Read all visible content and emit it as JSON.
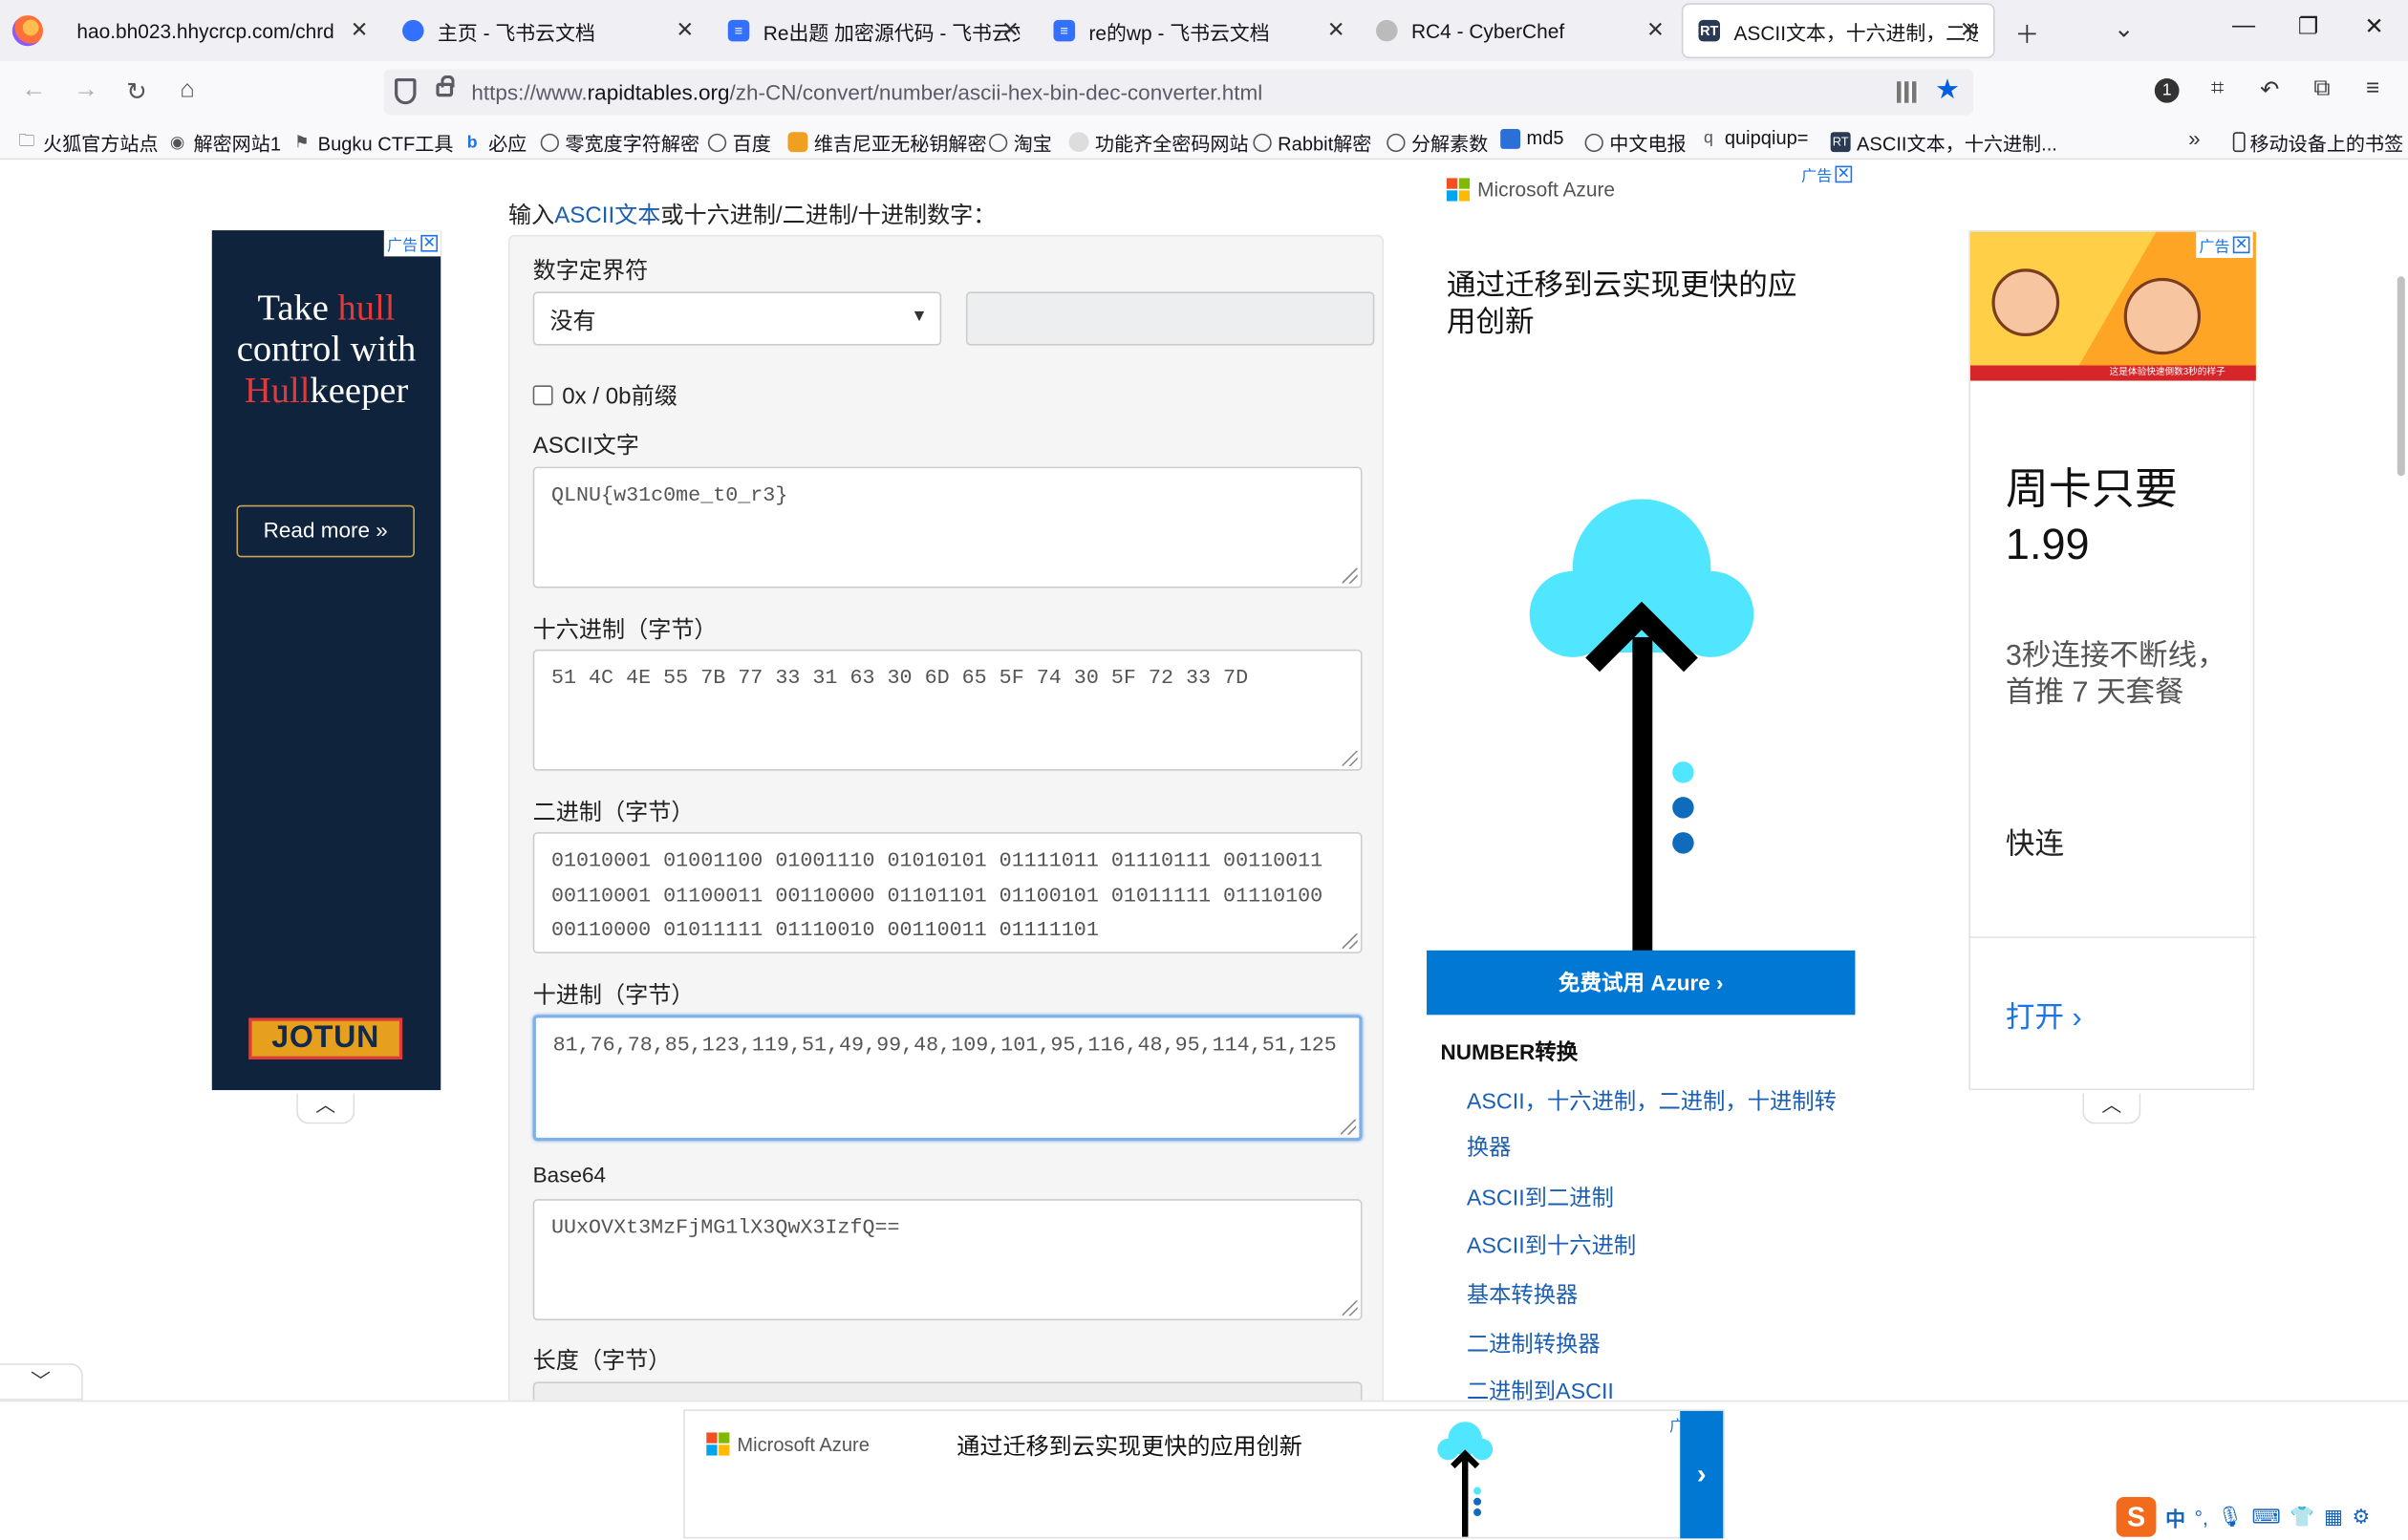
{
  "tabs": [
    {
      "title": "hao.bh023.hhycrcp.com/chrd",
      "icon_color": "",
      "icon_text": ""
    },
    {
      "title": "主页 - 飞书云文档",
      "icon_color": "#3370ff",
      "icon_text": ""
    },
    {
      "title": "Re出题 加密源代码 - 飞书云文档",
      "icon_color": "#3370ff",
      "icon_text": ""
    },
    {
      "title": "re的wp - 飞书云文档",
      "icon_color": "#3370ff",
      "icon_text": ""
    },
    {
      "title": "RC4 - CyberChef",
      "icon_color": "#bbbbbb",
      "icon_text": ""
    },
    {
      "title": "ASCII文本，十六进制，二进制",
      "icon_color": "#2a3a55",
      "icon_text": "RT"
    }
  ],
  "url": {
    "prefix": "https://www.",
    "domain": "rapidtables.org",
    "path": "/zh-CN/convert/number/ascii-hex-bin-dec-converter.html"
  },
  "bookmarks": [
    {
      "label": "火狐官方站点",
      "icon": "folder-icon"
    },
    {
      "label": "解密网站1",
      "icon": "site-icon"
    },
    {
      "label": "Bugku CTF工具",
      "icon": "flag-icon"
    },
    {
      "label": "必应",
      "icon": "bing-icon"
    },
    {
      "label": "零宽度字符解密",
      "icon": "globe-icon"
    },
    {
      "label": "百度",
      "icon": "globe-icon"
    },
    {
      "label": "维吉尼亚无秘钥解密",
      "icon": "site-icon"
    },
    {
      "label": "淘宝",
      "icon": "globe-icon"
    },
    {
      "label": "功能齐全密码网站",
      "icon": "site-icon"
    },
    {
      "label": "Rabbit解密",
      "icon": "globe-icon"
    },
    {
      "label": "分解素数",
      "icon": "globe-icon"
    },
    {
      "label": "md5",
      "icon": "site-icon"
    },
    {
      "label": "中文电报",
      "icon": "globe-icon"
    },
    {
      "label": "quipqiup=",
      "icon": "q-icon"
    },
    {
      "label": "ASCII文本，十六进制...",
      "icon": "rt-icon"
    }
  ],
  "bookmarks_mobile": "移动设备上的书签",
  "left_ad": {
    "ad_label": "广告",
    "line1a": "Take ",
    "line1b": "hull",
    "line2": "control with",
    "line3a": "Hull",
    "line3b": "keeper",
    "button": "Read more »",
    "brand": "JOTUN"
  },
  "form": {
    "intro_prefix": "输入",
    "intro_link": "ASCII文本",
    "intro_suffix": "或十六进制/二进制/十进制数字：",
    "delimiter_label": "数字定界符",
    "delimiter_value": "没有",
    "prefix_checkbox_label": "0x / 0b前缀",
    "ascii_label": "ASCII文字",
    "ascii_value": "QLNU{w31c0me_t0_r3}",
    "hex_label": "十六进制（字节）",
    "hex_value": "51 4C 4E 55 7B 77 33 31 63 30 6D 65 5F 74 30 5F 72 33 7D",
    "bin_label": "二进制（字节）",
    "bin_value": "01010001 01001100 01001110 01010101 01111011 01110111 00110011 00110001 01100011 00110000 01101101 01100101 01011111 01110100 00110000 01011111 01110010 00110011 01111101",
    "dec_label": "十进制（字节）",
    "dec_value": "81,76,78,85,123,119,51,49,99,48,109,101,95,116,48,95,114,51,125",
    "b64_label": "Base64",
    "b64_value": "UUxOVXt3MzFjMG1lX3QwX3IzfQ==",
    "length_label": "长度（字节）"
  },
  "azure_ad": {
    "ad_label": "广告",
    "brand": "Microsoft Azure",
    "title": "通过迁移到云实现更快的应用创新",
    "cta": "免费试用 Azure ›"
  },
  "side_nav": {
    "title": "NUMBER转换",
    "links": [
      "ASCII，十六进制，二进制，十进制转换器",
      "ASCII到二进制",
      "ASCII到十六进制",
      "基本转换器",
      "二进制转换器",
      "二进制到ASCII"
    ]
  },
  "right_ad": {
    "ad_label": "广告",
    "banner_caption": "这是体验快速倒数3秒的样子",
    "headline": "周卡只要1.99",
    "sub": "3秒连接不断线，首推 7 天套餐",
    "brand": "快连",
    "open": "打开 ›"
  },
  "bottom_ad": {
    "ad_label": "广告",
    "brand": "Microsoft Azure",
    "text": "通过迁移到云实现更快的应用创新",
    "arrow": "›"
  },
  "ime": {
    "lang": "中"
  }
}
